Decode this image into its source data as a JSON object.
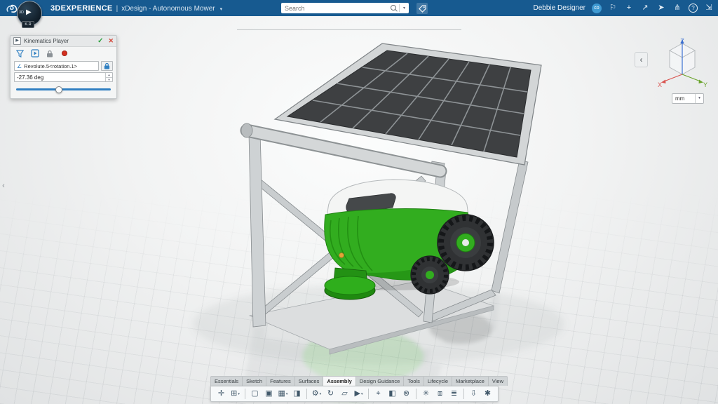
{
  "topbar": {
    "brand": "3DEXPERIENCE",
    "divider": "|",
    "app_title": "xDesign - Autonomous Mower",
    "search_placeholder": "Search",
    "user_name": "Debbie Designer",
    "user_badge": "co",
    "icons": {
      "bookmark": "⚐",
      "add": "+",
      "share": "↗",
      "send": "➤",
      "community": "⋔",
      "help": "?",
      "fullscreen": "⇲"
    }
  },
  "glyphs": {
    "caret": "▾",
    "caret_up": "▴",
    "left_chevron": "‹",
    "play": "▶"
  },
  "compass": {
    "top_label": "3D",
    "play": "▶",
    "bottom_label": "K.R"
  },
  "kinematics_player": {
    "title": "Kinematics Player",
    "header_icon": "▶",
    "status_ok": "✓",
    "status_close": "✕",
    "mechanism": "Revolute.5<rotation.1>",
    "mechanism_icon": "∠",
    "angle_value": "-27.36 deg",
    "slider_percent": 45
  },
  "view_controls": {
    "back_arrow": "‹",
    "axis_x": "X",
    "axis_y": "Y",
    "axis_z": "Z",
    "units": "mm"
  },
  "action_bar": {
    "active_tab": "Assembly",
    "tabs": [
      {
        "label": "Essentials"
      },
      {
        "label": "Sketch"
      },
      {
        "label": "Features"
      },
      {
        "label": "Surfaces"
      },
      {
        "label": "Assembly"
      },
      {
        "label": "Design Guidance"
      },
      {
        "label": "Tools"
      },
      {
        "label": "Lifecycle"
      },
      {
        "label": "Marketplace"
      },
      {
        "label": "View"
      }
    ],
    "tools": [
      {
        "name": "manipulators",
        "glyph": "✛"
      },
      {
        "name": "insert-component",
        "glyph": "⊞"
      },
      {
        "name": "new-3d-part",
        "glyph": "▢"
      },
      {
        "name": "new-assembly",
        "glyph": "▣"
      },
      {
        "name": "pattern",
        "glyph": "▦"
      },
      {
        "name": "mirror",
        "glyph": "◨"
      },
      {
        "name": "engineering-connection",
        "glyph": "⚙"
      },
      {
        "name": "revolute-joint",
        "glyph": "↻"
      },
      {
        "name": "planar-joint",
        "glyph": "▱"
      },
      {
        "name": "kinematics-player",
        "glyph": "▶"
      },
      {
        "name": "measure",
        "glyph": "⌖"
      },
      {
        "name": "section",
        "glyph": "◧"
      },
      {
        "name": "clash",
        "glyph": "⊗"
      },
      {
        "name": "explode",
        "glyph": "✳"
      },
      {
        "name": "snapshot",
        "glyph": "⧈"
      },
      {
        "name": "bom",
        "glyph": "≣"
      },
      {
        "name": "export",
        "glyph": "⇩"
      },
      {
        "name": "settings",
        "glyph": "✱"
      }
    ]
  },
  "colors": {
    "topbar_blue": "#175a90",
    "accent_blue": "#2f7fc1",
    "mower_green": "#32ad1f",
    "status_green": "#2aa13c",
    "status_red": "#d23f31",
    "axis_x_red": "#d9534f",
    "axis_y_green": "#6aa42c",
    "axis_z_blue": "#3b6fd1"
  }
}
